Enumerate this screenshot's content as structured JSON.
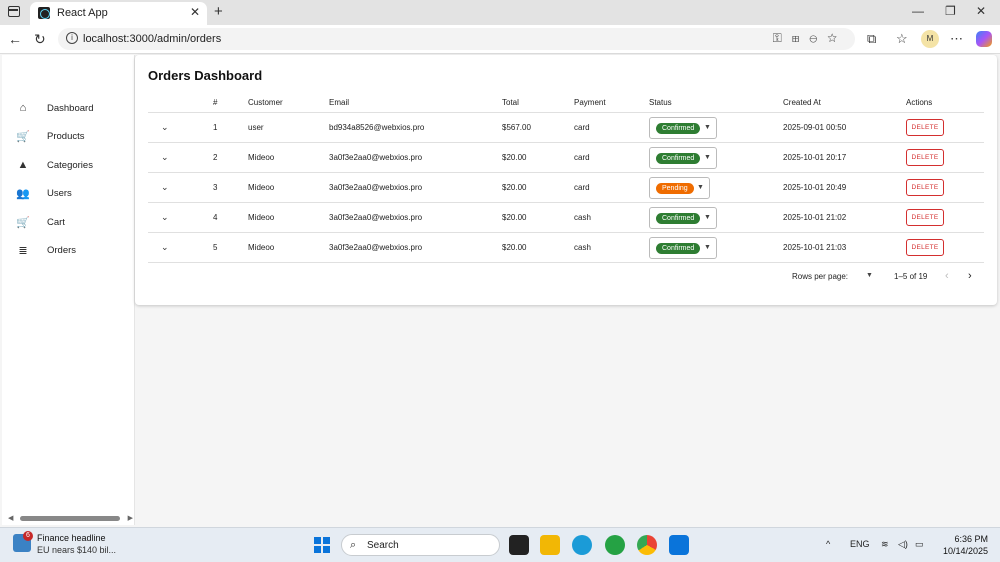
{
  "browser": {
    "tab_title": "React App",
    "url": "localhost:3000/admin/orders"
  },
  "profile_initial": "M",
  "sidebar": {
    "items": [
      {
        "label": "Dashboard",
        "icon": "home-icon",
        "glyph": "⌂"
      },
      {
        "label": "Products",
        "icon": "cart-icon",
        "glyph": "🛒"
      },
      {
        "label": "Categories",
        "icon": "category-icon",
        "glyph": "▲"
      },
      {
        "label": "Users",
        "icon": "users-icon",
        "glyph": "👥"
      },
      {
        "label": "Cart",
        "icon": "cart-icon",
        "glyph": "🛒"
      },
      {
        "label": "Orders",
        "icon": "receipt-icon",
        "glyph": "≣"
      }
    ]
  },
  "page": {
    "title": "Orders Dashboard"
  },
  "table": {
    "headers": [
      "#",
      "Customer",
      "Email",
      "Total",
      "Payment",
      "Status",
      "Created At",
      "Actions"
    ],
    "rows": [
      {
        "id": "1",
        "customer": "user",
        "email": "bd934a8526@webxios.pro",
        "total": "$567.00",
        "payment": "card",
        "status": "Confirmed",
        "created_at": "2025-09-01 00:50",
        "action": "DELETE"
      },
      {
        "id": "2",
        "customer": "Mideoo",
        "email": "3a0f3e2aa0@webxios.pro",
        "total": "$20.00",
        "payment": "card",
        "status": "Confirmed",
        "created_at": "2025-10-01 20:17",
        "action": "DELETE"
      },
      {
        "id": "3",
        "customer": "Mideoo",
        "email": "3a0f3e2aa0@webxios.pro",
        "total": "$20.00",
        "payment": "card",
        "status": "Pending",
        "created_at": "2025-10-01 20:49",
        "action": "DELETE"
      },
      {
        "id": "4",
        "customer": "Mideoo",
        "email": "3a0f3e2aa0@webxios.pro",
        "total": "$20.00",
        "payment": "cash",
        "status": "Confirmed",
        "created_at": "2025-10-01 21:02",
        "action": "DELETE"
      },
      {
        "id": "5",
        "customer": "Mideoo",
        "email": "3a0f3e2aa0@webxios.pro",
        "total": "$20.00",
        "payment": "cash",
        "status": "Confirmed",
        "created_at": "2025-10-01 21:03",
        "action": "DELETE"
      }
    ]
  },
  "pagination": {
    "rows_per_page_label": "Rows per page:",
    "page_info": "1–5 of 19"
  },
  "colors": {
    "confirmed": "#2e7d32",
    "pending": "#ef6c00",
    "delete": "#d32f2f"
  },
  "taskbar": {
    "news_badge": "6",
    "news_title": "Finance headline",
    "news_sub": "EU nears $140 bil...",
    "search_placeholder": "Search",
    "lang": "ENG",
    "time": "6:36 PM",
    "date": "10/14/2025"
  }
}
